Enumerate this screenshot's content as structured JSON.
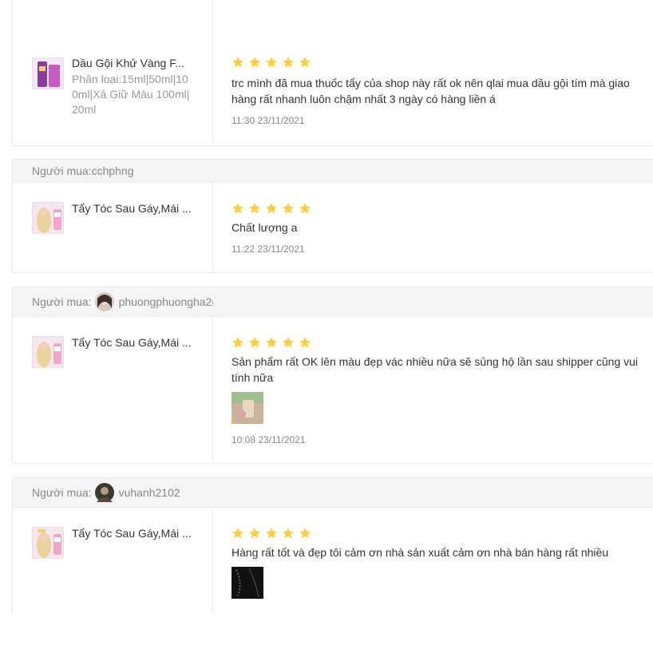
{
  "reviews": [
    {
      "product_name": "Dầu Gội Khử Vàng F...",
      "variant": "Phân loại:15ml|50ml|100ml|Xả Giữ Màu 100ml|20ml",
      "rating": 5,
      "comment": "trc mình đã mua thuốc tẩy của shop này rất ok nên qlai mua dầu gội tím mà giao hàng rất nhanh luôn chậm nhất 3 ngày có hàng liền á",
      "time": "11:30 23/11/2021"
    },
    {
      "buyer_label": "Người mua:",
      "buyer": "cchphng",
      "product_name": "Tẩy Tóc Sau Gáy,Mái ...",
      "rating": 5,
      "comment": "Chất lượng a",
      "time": "11:22 23/11/2021"
    },
    {
      "buyer_label": "Người mua:",
      "buyer": "phuongphuongha2(",
      "product_name": "Tẩy Tóc Sau Gáy,Mái ...",
      "rating": 5,
      "comment": "Sản phẩm rất OK lên màu đẹp vác nhiều nữa sẽ sủng hộ lần sau shipper cũng vui tính nữa",
      "time": "10:08 23/11/2021"
    },
    {
      "buyer_label": "Người mua:",
      "buyer": "vuhanh2102",
      "product_name": "Tẩy Tóc Sau Gáy,Mái ...",
      "rating": 5,
      "comment": "Hàng rất tốt và đẹp tôi cảm ơn nhà sản xuất cảm ơn nhà bán hàng rất nhiều"
    }
  ],
  "colors": {
    "star": "#ffce3d",
    "header_bg": "#f5f5f5"
  }
}
